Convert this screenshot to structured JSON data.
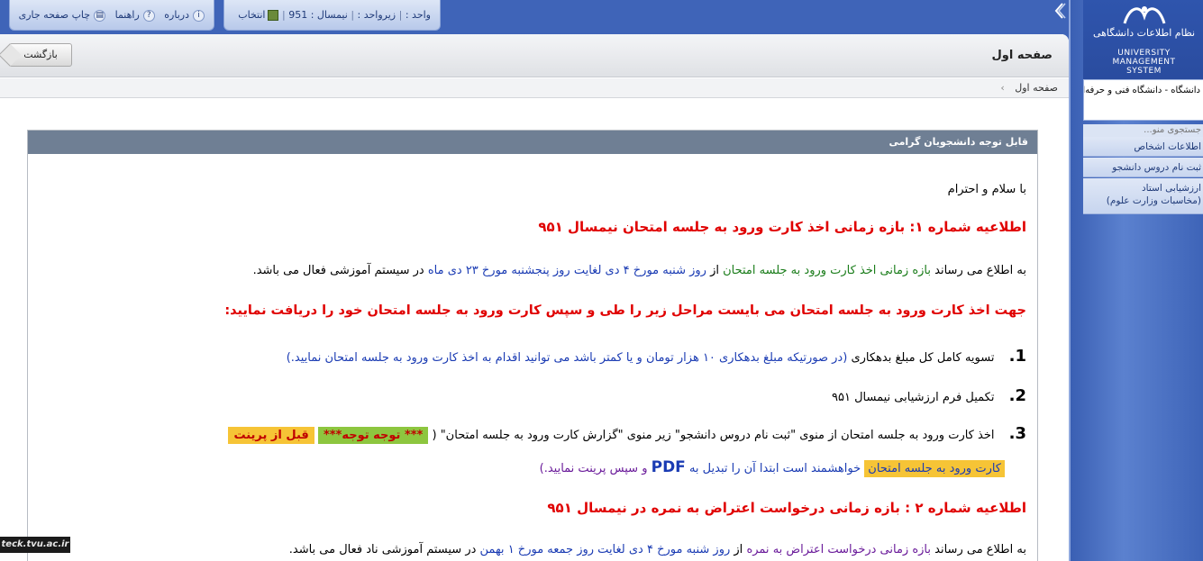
{
  "toolbar_left": {
    "about_label": "درباره",
    "help_label": "راهنما",
    "print_label": "چاپ صفحه جاری"
  },
  "toolbar_mid": {
    "unit_label": "واحد :",
    "subunit_label": "زیرواحد :",
    "semester_label": "نیمسال :",
    "semester_value": "951",
    "select_label": "انتخاب"
  },
  "sidebar": {
    "logo_fa": "نظام اطلاعات دانشگاهی",
    "logo_en_1": "UNIVERSITY",
    "logo_en_2": "MANAGEMENT",
    "logo_en_3": "SYSTEM",
    "university": "دانشگاه - دانشگاه فنی و حرفه‌ای",
    "search_placeholder": "جستجوی منو...",
    "items": [
      {
        "label": "اطلاعات اشخاص"
      },
      {
        "label": "ثبت نام دروس دانشجو"
      },
      {
        "label_1": "ارزشیابی استاد",
        "label_2": "(مخاسبات وزارت علوم)"
      }
    ]
  },
  "header": {
    "page_title": "صفحه اول",
    "back_label": "بازگشت",
    "breadcrumb": "صفحه اول"
  },
  "notice": {
    "heading": "قابل توجه دانشجویان گرامی",
    "greeting": "با سلام و احترام",
    "ann1_title": "اطلاعیه شماره ۱: بازه زمانی اخذ کارت ورود به جلسه امتحان نیمسال ۹۵۱",
    "p1": {
      "a": "به اطلاع می رساند",
      "b": "بازه زمانی اخذ کارت ورود به جلسه امتحان",
      "c": "از",
      "d": "روز شنبه مورخ ۴ دی لغایت روز پنجشنبه مورخ ۲۳ دی ماه",
      "e": "در سیستم آموزشی فعال می باشد."
    },
    "steps_title": "جهت اخذ کارت ورود به جلسه امتحان می بایست مراحل زیر را طی و سپس کارت ورود به جلسه امتحان خود را دریافت نمایید:",
    "step1": {
      "num": "1.",
      "a": "تسویه کامل کل مبلغ بدهکاری",
      "b": "(در صورتیکه مبلغ بدهکاری ۱۰ هزار تومان و یا کمتر باشد می توانید اقدام به اخذ کارت ورود به جلسه امتحان نمایید.)"
    },
    "step2": {
      "num": "2.",
      "a": "تکمیل فرم ارزشیابی نیمسال ۹۵۱"
    },
    "step3": {
      "num": "3.",
      "a": "اخذ کارت ورود به جلسه امتحان از منوی \"ثبت نام دروس دانشجو\" زیر منوی \"گزارش کارت  ورود به جلسه امتحان\" (",
      "hl_green": "*** توجه توجه***",
      "hl_orange": "قبل از پرینت",
      "hl_yellow": "کارت ورود به جلسه امتحان",
      "b": "خواهشمند است ابتدا آن را تبدیل به",
      "pdf": "PDF",
      "c": "و سپس پرینت نمایید.)"
    },
    "ann2_title": "اطلاعیه شماره ۲ : بازه زمانی درخواست اعتراض به نمره در نیمسال ۹۵۱",
    "p2": {
      "a": "به اطلاع می رساند",
      "b": "بازه زمانی درخواست اعتراض به نمره",
      "c": "از",
      "d": "روز شنبه مورخ ۴ دی لغایت روز جمعه مورخ ۱ بهمن",
      "e": "در سیستم آموزشی ناد فعال می باشد."
    }
  },
  "watermark": "teck.tvu.ac.ir"
}
